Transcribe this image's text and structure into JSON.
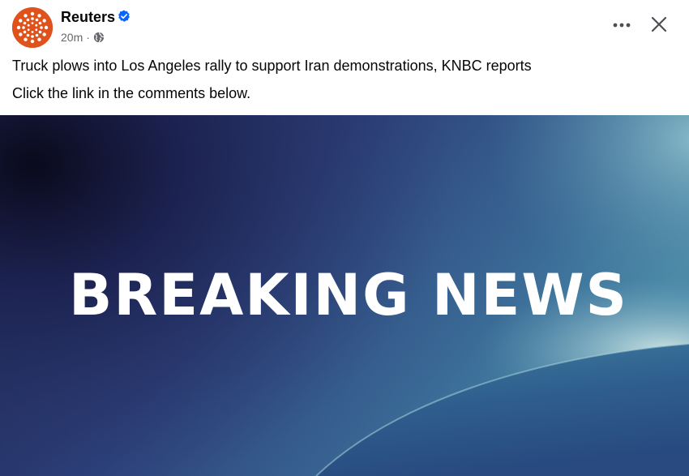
{
  "post": {
    "author": "Reuters",
    "verified": true,
    "timestamp": "20m",
    "separator": "·",
    "audience_icon": "globe-icon",
    "text_lines": [
      "Truck plows into Los Angeles rally to support Iran demonstrations, KNBC reports",
      "Click the link in the comments below."
    ],
    "image": {
      "headline": "BREAKING NEWS"
    }
  },
  "header_actions": {
    "more_icon": "more-options-icon",
    "close_icon": "close-icon"
  },
  "colors": {
    "avatar_brand": "#e0521c",
    "verified_blue": "#0866ff",
    "meta_gray": "#65676b",
    "image_navy": "#2a3a6e",
    "image_teal": "#4a8fa8"
  }
}
